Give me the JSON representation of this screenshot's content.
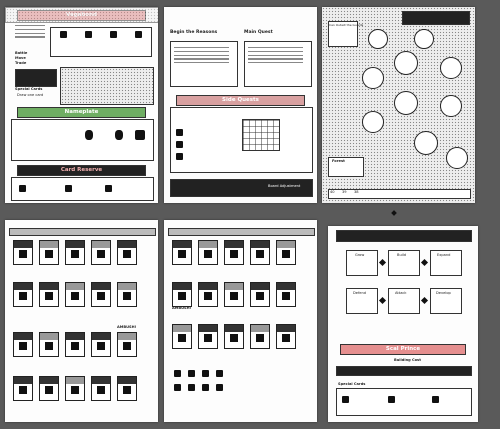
{
  "pages": [
    {
      "id": 1,
      "banners": [
        "Vagabond",
        "Nameplate",
        "Card Reserve"
      ],
      "labels": [
        "Special Cards",
        "Draw one card",
        "Nameplate"
      ]
    },
    {
      "id": 2,
      "headings": [
        "Begin the Reasons",
        "Main Quest"
      ],
      "banner": "Side Quests",
      "labels": [
        "Board Adjustment"
      ]
    },
    {
      "id": 3,
      "labels": [
        "Can Outwit the Guards",
        "Forest"
      ]
    },
    {
      "id": 4,
      "labels": [
        "AMBUSH!"
      ]
    },
    {
      "id": 5,
      "labels": [
        "AMBUSH!"
      ]
    },
    {
      "id": 6,
      "banner": "Scal Prince",
      "labels": [
        "Building Cost",
        "Special Cards"
      ]
    }
  ],
  "page1": {
    "banner_top": "Vagabond",
    "banner_mid": "Nameplate",
    "banner_bot": "Card Reserve",
    "list": [
      "Battle",
      "Move",
      "Trade"
    ],
    "special_cards": "Special Cards",
    "left_note": "Draw one card"
  },
  "page2": {
    "title_left": "Begin the Reasons",
    "title_right": "Main Quest",
    "banner": "Side Quests",
    "footer": "Board Adjustment"
  },
  "page3": {
    "corner_label": "Can Outwit the Guards",
    "bottom_label": "Forest",
    "numbers": [
      "40",
      "39",
      "38",
      "37",
      "36",
      "35",
      "34",
      "33",
      "32",
      "31",
      "30"
    ]
  },
  "page4": {
    "ambush": "AMBUSH!"
  },
  "page5": {
    "ambush": "AMBUSH!"
  },
  "page6": {
    "banner": "Scal Prince",
    "building_cost": "Building Cost",
    "special_cards": "Special Cards",
    "boxes": [
      "Grow",
      "Build",
      "Expand",
      "Defend",
      "Attack",
      "Develop"
    ]
  }
}
